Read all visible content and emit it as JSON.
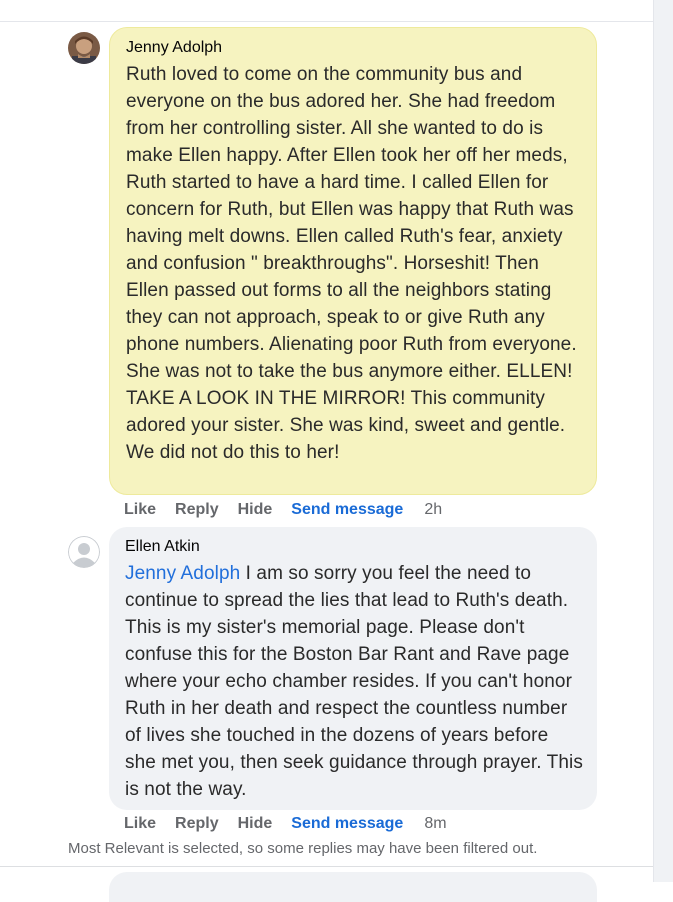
{
  "comments": [
    {
      "author": "Jenny Adolph",
      "mention": "",
      "text": "Ruth loved to come on the community bus and everyone on the bus adored her. She had freedom from her controlling sister. All she wanted to do is make Ellen happy. After Ellen took her off her meds, Ruth started to have a hard time. I called Ellen for concern for Ruth, but Ellen was happy that Ruth was having melt downs. Ellen called Ruth's fear, anxiety and confusion \" breakthroughs\". Horseshit! Then Ellen passed out forms to all the neighbors stating they can not approach, speak to or give Ruth any phone numbers. Alienating poor Ruth from everyone. She was not to take the bus anymore either. ELLEN! TAKE A LOOK IN THE MIRROR! This community adored your sister. She was kind, sweet and gentle. We did not do this to her!",
      "highlighted": true,
      "actions": {
        "like": "Like",
        "reply": "Reply",
        "hide": "Hide",
        "send_message": "Send message"
      },
      "time": "2h"
    },
    {
      "author": "Ellen Atkin",
      "mention": "Jenny Adolph",
      "text": " I am so sorry you feel the need to continue to spread the lies that lead to Ruth's death. This is my sister's memorial page. Please don't confuse this for the Boston Bar Rant and Rave page where your echo chamber resides. If you can't honor Ruth in her death and respect the countless number of lives she touched in the dozens of years before she met you, then seek guidance through prayer. This is not the way.",
      "highlighted": false,
      "actions": {
        "like": "Like",
        "reply": "Reply",
        "hide": "Hide",
        "send_message": "Send message"
      },
      "time": "8m"
    }
  ],
  "filter_note": "Most Relevant is selected, so some replies may have been filtered out.",
  "colors": {
    "highlight_bubble": "#f6f3c0",
    "plain_bubble": "#f0f2f5",
    "link_blue": "#1a6bd6",
    "muted_gray": "#65676b"
  }
}
